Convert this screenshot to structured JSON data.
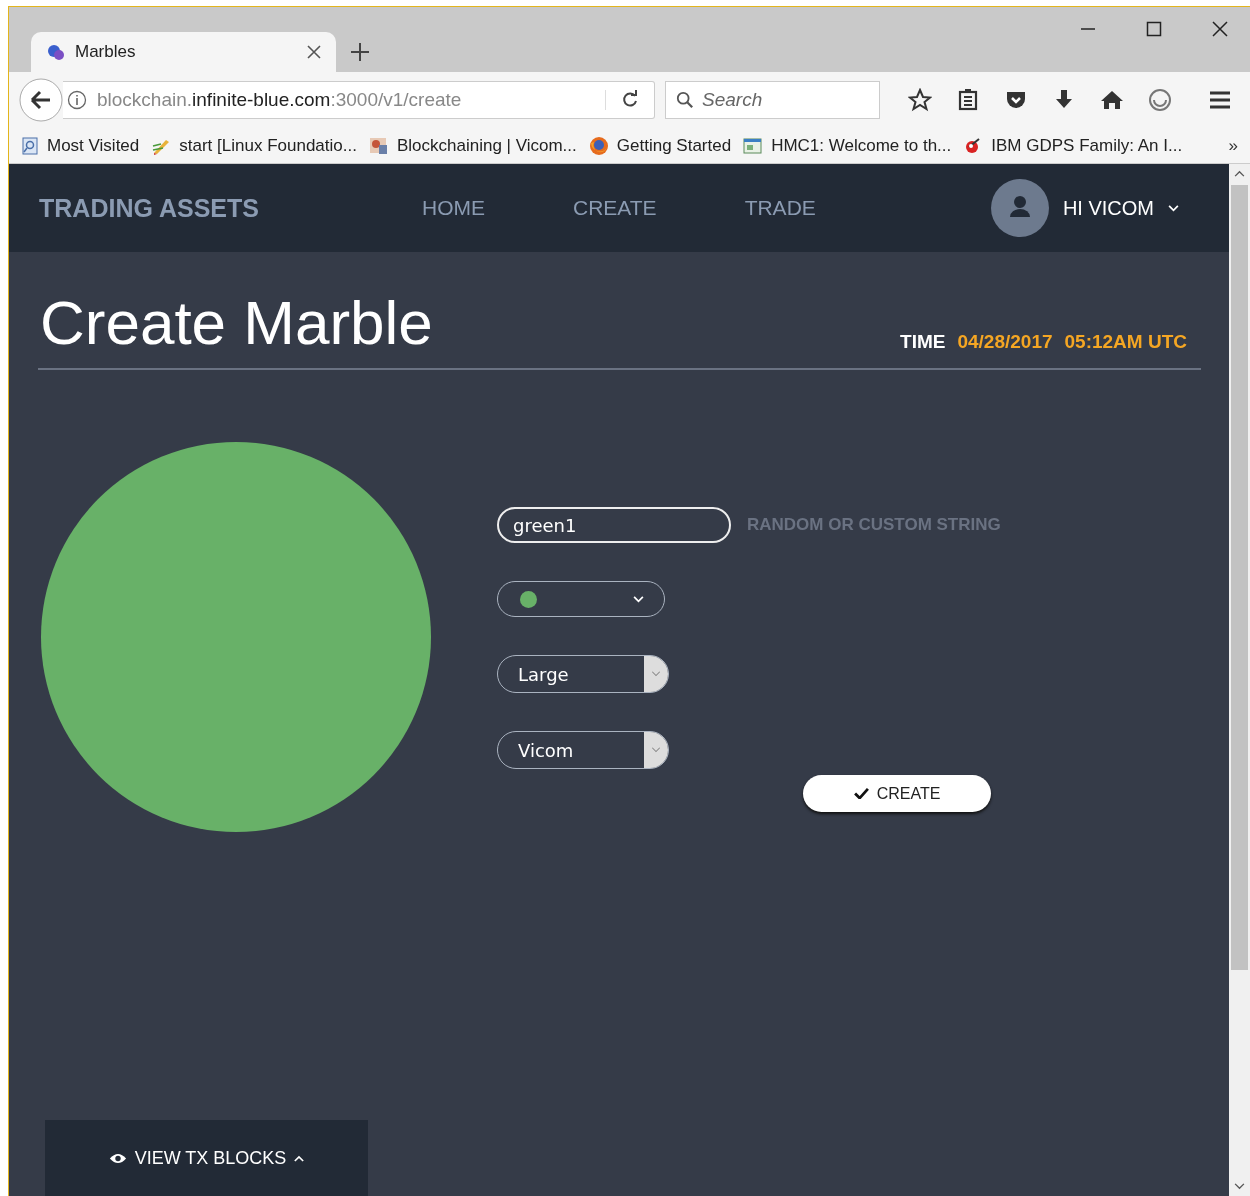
{
  "browser": {
    "tab": {
      "title": "Marbles"
    },
    "address": {
      "prefix": "blockchain.",
      "domain": "infinite-blue.com",
      "path": ":3000/v1/create"
    },
    "search": {
      "placeholder": "Search"
    },
    "bookmarks": [
      {
        "label": "Most Visited"
      },
      {
        "label": "start [Linux Foundatio..."
      },
      {
        "label": "Blockchaining | Vicom..."
      },
      {
        "label": "Getting Started"
      },
      {
        "label": "HMC1: Welcome to th..."
      },
      {
        "label": "IBM GDPS Family: An I..."
      }
    ],
    "overflow": "»"
  },
  "navbar": {
    "brand": "TRADING ASSETS",
    "links": [
      "HOME",
      "CREATE",
      "TRADE"
    ],
    "user": "HI VICOM"
  },
  "page": {
    "title": "Create Marble",
    "time_label": "TIME",
    "date": "04/28/2017",
    "time": "05:12AM UTC"
  },
  "form": {
    "name": {
      "value": "green1"
    },
    "name_hint": "RANDOM OR CUSTOM STRING",
    "color": "#68b168",
    "size": "Large",
    "owner": "Vicom",
    "submit": "CREATE"
  },
  "footer": {
    "tx_button": "VIEW TX BLOCKS"
  }
}
